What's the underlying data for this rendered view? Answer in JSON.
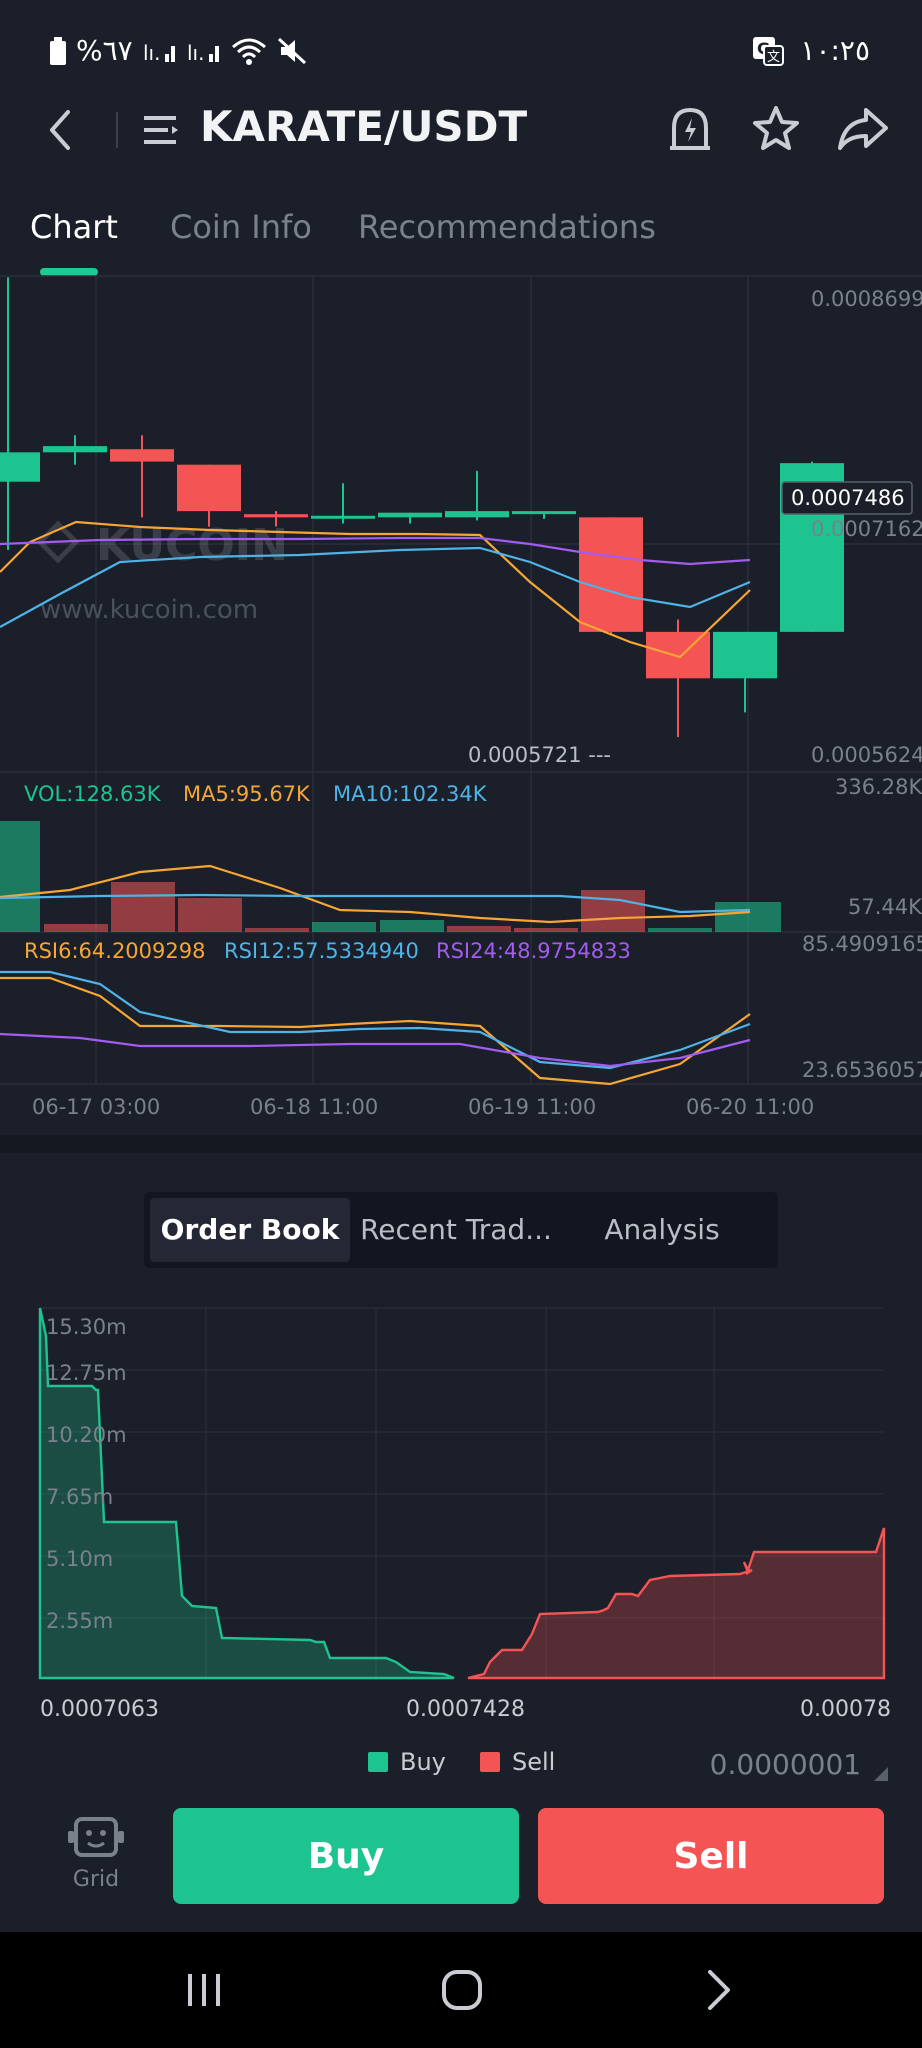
{
  "status_bar": {
    "battery": "%٦٧",
    "time": "١٠:٢٥"
  },
  "header": {
    "title": "KARATE/USDT",
    "icons": [
      "back-icon",
      "menu-list-icon",
      "price-alert-icon",
      "star-icon",
      "share-icon"
    ]
  },
  "tabs": [
    {
      "label": "Chart",
      "active": true
    },
    {
      "label": "Coin Info",
      "active": false
    },
    {
      "label": "Recommendations",
      "active": false
    }
  ],
  "chart": {
    "watermark_brand": "KUCOIN",
    "watermark_url": "www.kucoin.com",
    "price_axis": {
      "top": "0.0008699",
      "current": "0.0007486",
      "mid": "0.0007162",
      "bottom": "0.0005624",
      "low_marker": "0.0005721 ---"
    },
    "volume": {
      "vol": "VOL:128.63K",
      "ma5": "MA5:95.67K",
      "ma10": "MA10:102.34K",
      "axis_top": "336.28K",
      "axis_bottom": "57.44K"
    },
    "rsi": {
      "rsi6": "RSI6:64.2009298",
      "rsi12": "RSI12:57.5334940",
      "rsi24": "RSI24:48.9754833",
      "axis_top": "85.4909165",
      "axis_bottom": "23.6536057"
    },
    "time_labels": [
      "06-17 03:00",
      "06-18 11:00",
      "06-19 11:00",
      "06-20 11:00"
    ],
    "colors": {
      "up": "#1dc48f",
      "down": "#f55455",
      "ma5": "#f7a634",
      "ma10": "#4fb3e8",
      "ma30": "#a35cf0"
    }
  },
  "chart_data": {
    "type": "candlestick",
    "candles": [
      {
        "o": 0.000737,
        "h": 0.000869,
        "l": 0.000693,
        "c": 0.000756
      },
      {
        "o": 0.000756,
        "h": 0.000767,
        "l": 0.000748,
        "c": 0.00076
      },
      {
        "o": 0.000758,
        "h": 0.000767,
        "l": 0.000714,
        "c": 0.00075
      },
      {
        "o": 0.000748,
        "h": 0.000718,
        "l": 0.000708,
        "c": 0.000718
      },
      {
        "o": 0.000716,
        "h": 0.000718,
        "l": 0.000708,
        "c": 0.000714
      },
      {
        "o": 0.000714,
        "h": 0.000736,
        "l": 0.00071,
        "c": 0.000715
      },
      {
        "o": 0.000714,
        "h": 0.000716,
        "l": 0.00071,
        "c": 0.000717
      },
      {
        "o": 0.000714,
        "h": 0.000744,
        "l": 0.000712,
        "c": 0.000718
      },
      {
        "o": 0.000717,
        "h": 0.000718,
        "l": 0.000713,
        "c": 0.000718
      },
      {
        "o": 0.000714,
        "h": 0.000714,
        "l": 0.000638,
        "c": 0.00064
      },
      {
        "o": 0.00064,
        "h": 0.000648,
        "l": 0.000572,
        "c": 0.00061
      },
      {
        "o": 0.00061,
        "h": 0.00064,
        "l": 0.000588,
        "c": 0.00064
      },
      {
        "o": 0.00064,
        "h": 0.00075,
        "l": 0.00064,
        "c": 0.000749
      }
    ],
    "depth": {
      "x_labels": [
        "0.0007063",
        "0.0007428",
        "0.00078"
      ],
      "y_labels": [
        "15.30m",
        "12.75m",
        "10.20m",
        "7.65m",
        "5.10m",
        "2.55m"
      ],
      "series": [
        {
          "name": "Buy",
          "color": "#1dc48f"
        },
        {
          "name": "Sell",
          "color": "#f55455"
        }
      ]
    }
  },
  "order_tabs": [
    {
      "label": "Order Book",
      "active": true
    },
    {
      "label": "Recent Trad...",
      "active": false
    },
    {
      "label": "Analysis",
      "active": false
    }
  ],
  "legend": {
    "buy": "Buy",
    "sell": "Sell",
    "precision": "0.0000001"
  },
  "actions": {
    "grid": "Grid",
    "buy": "Buy",
    "sell": "Sell"
  }
}
